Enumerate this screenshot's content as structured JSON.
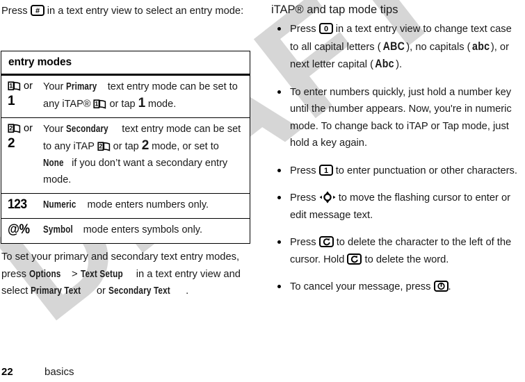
{
  "left_column": {
    "intro_paragraph_prefix": "Press ",
    "intro_paragraph_suffix": " in a text entry view to select an entry mode:",
    "intro_key_icon": "hash-key-icon",
    "table": {
      "header": "entry modes",
      "rows": [
        {
          "key_icon": "book-1-icon",
          "key_or": "or",
          "key_number": "1",
          "desc_part1": "Your ",
          "desc_bold1": "Primary",
          "desc_part2": " text entry mode can be set to any iTAP® ",
          "desc_icon": "book-1-icon",
          "desc_part3": " or tap ",
          "desc_number": "1",
          "desc_part4": " mode."
        },
        {
          "key_icon": "book-2-icon",
          "key_or": "or",
          "key_number": "2",
          "desc_part1": "Your ",
          "desc_bold1": "Secondary",
          "desc_part2": " text entry mode can be set to any iTAP ",
          "desc_icon": "book-2-icon",
          "desc_part3": " or tap ",
          "desc_number": "2",
          "desc_part4": " mode, or set to ",
          "desc_bold2": "None",
          "desc_part5": " if you don’t want a secondary entry mode."
        },
        {
          "key_label": "123",
          "desc_bold1": "Numeric",
          "desc_part1": " mode enters numbers only."
        },
        {
          "key_label": "@%",
          "desc_bold1": "Symbol",
          "desc_part1": " mode enters symbols only."
        }
      ]
    },
    "closing_part1": "To set your primary and secondary text entry modes, press ",
    "closing_bold1": "Options",
    "closing_part2": " > ",
    "closing_bold2": "Text Setup",
    "closing_part3": " in a text entry view and select ",
    "closing_bold3": "Primary Text",
    "closing_part4": " or ",
    "closing_bold4": "Secondary Text",
    "closing_part5": "."
  },
  "right_column": {
    "title": "iTAP® and tap mode tips",
    "bullets": [
      {
        "part1": "Press ",
        "icon1": "zero-key-icon",
        "part2": " in a text entry view to change text case to all capital letters (",
        "glyph1": "ABC",
        "part3": "), no capitals (",
        "glyph2": "abc",
        "part4": "), or next letter capital (",
        "glyph3": "Abc",
        "part5": ")."
      },
      {
        "part1": "To enter numbers quickly, just hold a number key until the number appears. Now, you're in numeric mode. To change back to iTAP or Tap mode, just hold a key again."
      },
      {
        "part1": "Press ",
        "icon1": "one-key-icon",
        "part2": " to enter punctuation or other characters."
      },
      {
        "part1": "Press ",
        "icon1": "navigation-key-icon",
        "part2": " to move the flashing cursor to enter or edit message text."
      },
      {
        "part1": "Press ",
        "icon1": "delete-key-icon",
        "part2": " to delete the character to the left of the cursor. Hold ",
        "icon2": "delete-key-icon",
        "part3": " to delete the word."
      },
      {
        "part1": "To cancel your message, press ",
        "icon1": "power-key-icon",
        "part2": "."
      }
    ]
  },
  "footer": {
    "page_number": "22",
    "section": "basics"
  },
  "watermark": {
    "text": "DRAFT",
    "color": "#d6d6d6"
  },
  "colors": {
    "text": "#1a1a1a",
    "rule": "#000000",
    "background": "#ffffff"
  }
}
